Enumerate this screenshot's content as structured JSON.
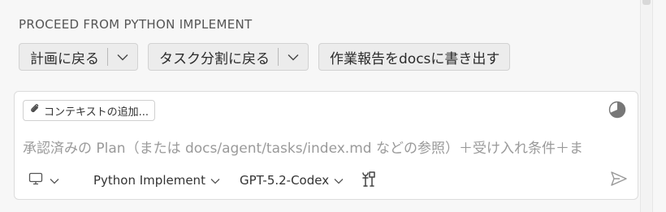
{
  "header": {
    "proceed_label": "PROCEED FROM PYTHON IMPLEMENT"
  },
  "actions": [
    {
      "label": "計画に戻る"
    },
    {
      "label": "タスク分割に戻る"
    },
    {
      "label": "作業報告をdocsに書き出す"
    }
  ],
  "composer": {
    "context_chip_label": "コンテキストの追加...",
    "placeholder": "承認済みの Plan（または docs/agent/tasks/index.md などの参照）＋受け入れ条件＋ま",
    "mode_label": "Python Implement",
    "model_label": "GPT-5.2-Codex"
  },
  "icons": {
    "paperclip": "paperclip-icon",
    "usage": "context-usage-icon",
    "monitor": "monitor-icon",
    "tools": "tools-icon",
    "send": "send-icon"
  }
}
